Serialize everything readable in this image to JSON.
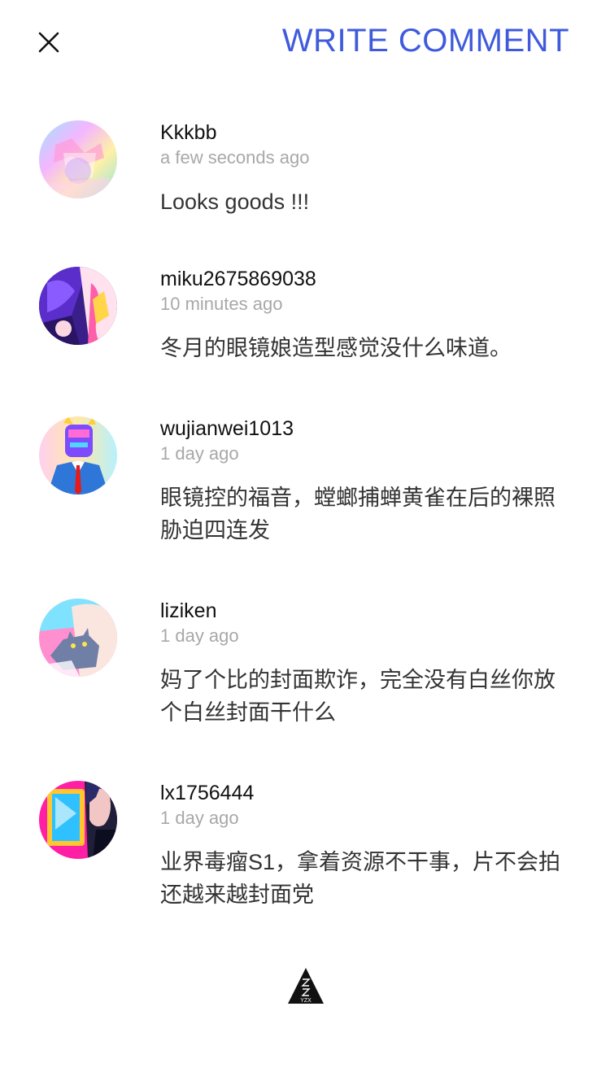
{
  "header": {
    "write_comment_label": "WRITE COMMENT"
  },
  "comments": [
    {
      "username": "Kkkbb",
      "time": "a few seconds ago",
      "text": "Looks goods !!!",
      "avatar": "pastel-rainbow-avatar"
    },
    {
      "username": "miku2675869038",
      "time": "10 minutes ago",
      "text": "冬月的眼镜娘造型感觉没什么味道。",
      "avatar": "purple-hair-avatar"
    },
    {
      "username": "wujianwei1013",
      "time": "1 day ago",
      "text": "眼镜控的福音，螳螂捕蝉黄雀在后的裸照胁迫四连发",
      "avatar": "suit-figure-avatar"
    },
    {
      "username": "liziken",
      "time": "1 day ago",
      "text": "妈了个比的封面欺诈，完全没有白丝你放个白丝封面干什么",
      "avatar": "cat-pink-avatar"
    },
    {
      "username": "lx1756444",
      "time": "1 day ago",
      "text": "业界毒瘤S1，拿着资源不干事，片不会拍还越来越封面党",
      "avatar": "mirror-portrait-avatar"
    }
  ],
  "footer": {
    "logo_text": "YZX"
  }
}
